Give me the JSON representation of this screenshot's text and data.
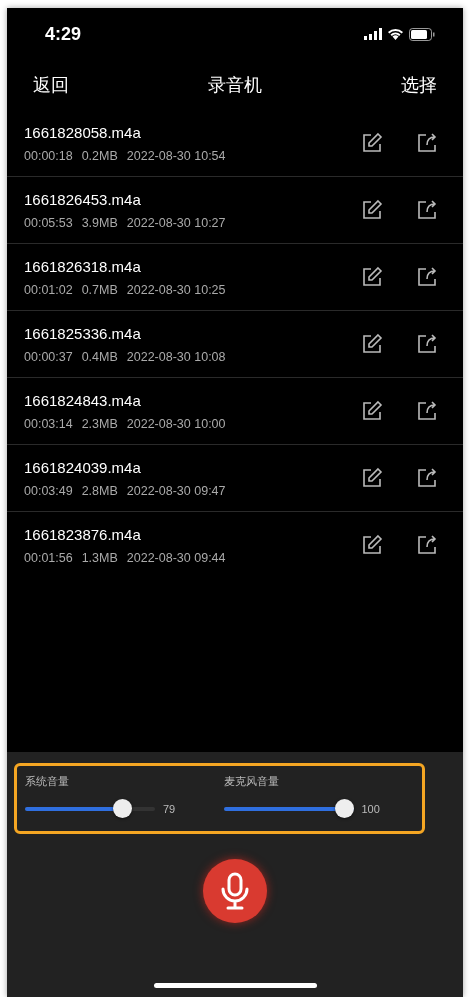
{
  "status_bar": {
    "time": "4:29"
  },
  "nav": {
    "back": "返回",
    "title": "录音机",
    "action": "选择"
  },
  "recordings": [
    {
      "name": "1661828058.m4a",
      "duration": "00:00:18",
      "size": "0.2MB",
      "date": "2022-08-30 10:54"
    },
    {
      "name": "1661826453.m4a",
      "duration": "00:05:53",
      "size": "3.9MB",
      "date": "2022-08-30 10:27"
    },
    {
      "name": "1661826318.m4a",
      "duration": "00:01:02",
      "size": "0.7MB",
      "date": "2022-08-30 10:25"
    },
    {
      "name": "1661825336.m4a",
      "duration": "00:00:37",
      "size": "0.4MB",
      "date": "2022-08-30 10:08"
    },
    {
      "name": "1661824843.m4a",
      "duration": "00:03:14",
      "size": "2.3MB",
      "date": "2022-08-30 10:00"
    },
    {
      "name": "1661824039.m4a",
      "duration": "00:03:49",
      "size": "2.8MB",
      "date": "2022-08-30 09:47"
    },
    {
      "name": "1661823876.m4a",
      "duration": "00:01:56",
      "size": "1.3MB",
      "date": "2022-08-30 09:44"
    }
  ],
  "volumes": [
    {
      "label": "系统音量",
      "level": 0.79,
      "reading": "79"
    },
    {
      "label": "麦克风音量",
      "level": 1,
      "reading": "100"
    }
  ]
}
